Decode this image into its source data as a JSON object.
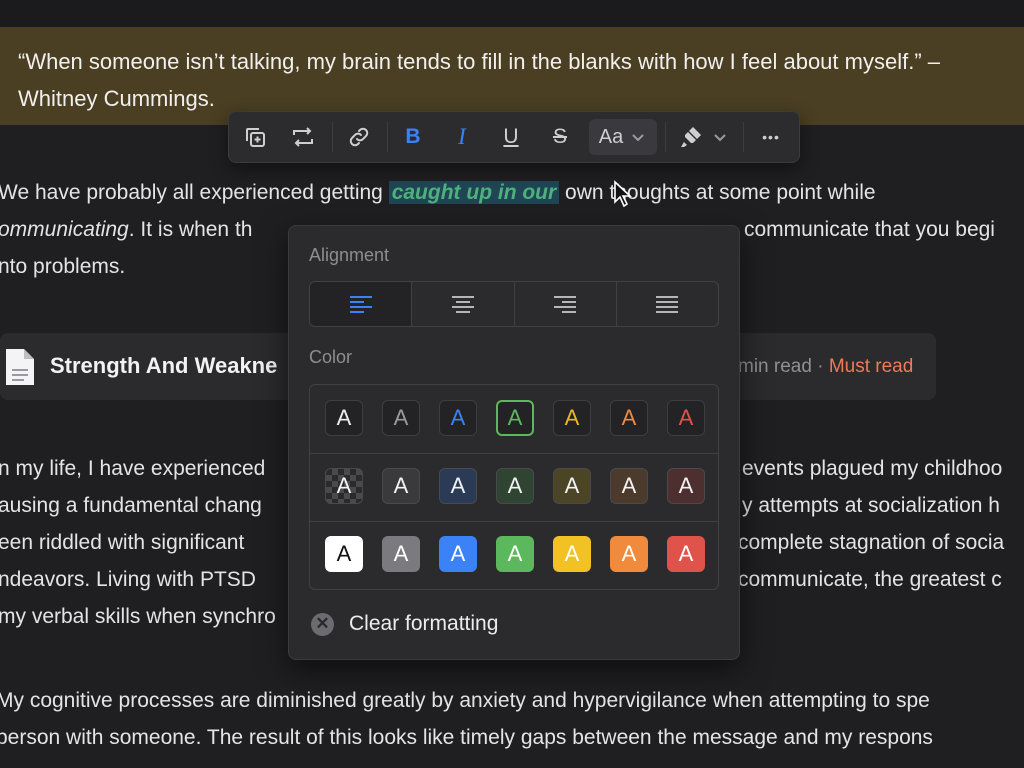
{
  "quote": {
    "line1": "“When someone isn’t talking, my brain tends to fill in the blanks with how I feel about myself.” –",
    "line2": "Whitney Cummings."
  },
  "toolbar": {
    "items": [
      "duplicate-icon",
      "crop-icon",
      "link-icon",
      "B",
      "I",
      "U",
      "S",
      "Aa",
      "highlighter-icon",
      "more-icon"
    ],
    "bold": "B",
    "italic": "I",
    "underline": "U",
    "strike": "S",
    "text_style": "Aa",
    "more": "•••",
    "accent": "#3b82f6"
  },
  "body": {
    "p1_l1_pre": "We have probably all experienced getting ",
    "p1_l1_hl": "caught up in our",
    "p1_l1_post": " own thoughts at some point while",
    "p1_l2_ital": "ommunicating",
    "p1_l2_rest": ". It is when th",
    "p1_l2_right": "communicate that you begi",
    "p1_l3": "nto problems.",
    "p2_left": [
      "n my life, I have experienced",
      "ausing a fundamental chang",
      "een riddled with significant",
      "ndeavors. Living with PTSD",
      "my verbal skills when synchro"
    ],
    "p2_right": [
      "events plagued my childhoo",
      "y attempts at socialization h",
      "complete stagnation of socia",
      "communicate, the greatest c"
    ],
    "p3": [
      "My cognitive processes are diminished greatly by anxiety and hypervigilance when attempting to spe",
      "person with someone. The result of this looks like timely gaps between the message and my respons"
    ]
  },
  "card": {
    "title": "Strength And Weakne",
    "meta": "min read",
    "dot": " · ",
    "must": "Must read"
  },
  "popover": {
    "alignment_label": "Alignment",
    "alignment_options": [
      "align-left",
      "align-center",
      "align-right",
      "align-justify"
    ],
    "alignment_selected": "align-left",
    "color_label": "Color",
    "text_colors": [
      "#eeeeee",
      "#9a9a9e",
      "#3b82f6",
      "#5cb85c",
      "#e9b824",
      "#f08a3c",
      "#e0534a"
    ],
    "bg_colors": [
      "checker",
      "#3a3a3d",
      "#2b3a55",
      "#2f4532",
      "#4b4425",
      "#4c3a2c",
      "#4d2f2f"
    ],
    "solid_colors": [
      "#ffffff",
      "#7b7b7f",
      "#3b82f6",
      "#5cb85c",
      "#f2c224",
      "#f08a3c",
      "#e0534a"
    ],
    "swatch_letter": "A",
    "selected_text_color": "#5cb85c",
    "clear_label": "Clear formatting"
  }
}
